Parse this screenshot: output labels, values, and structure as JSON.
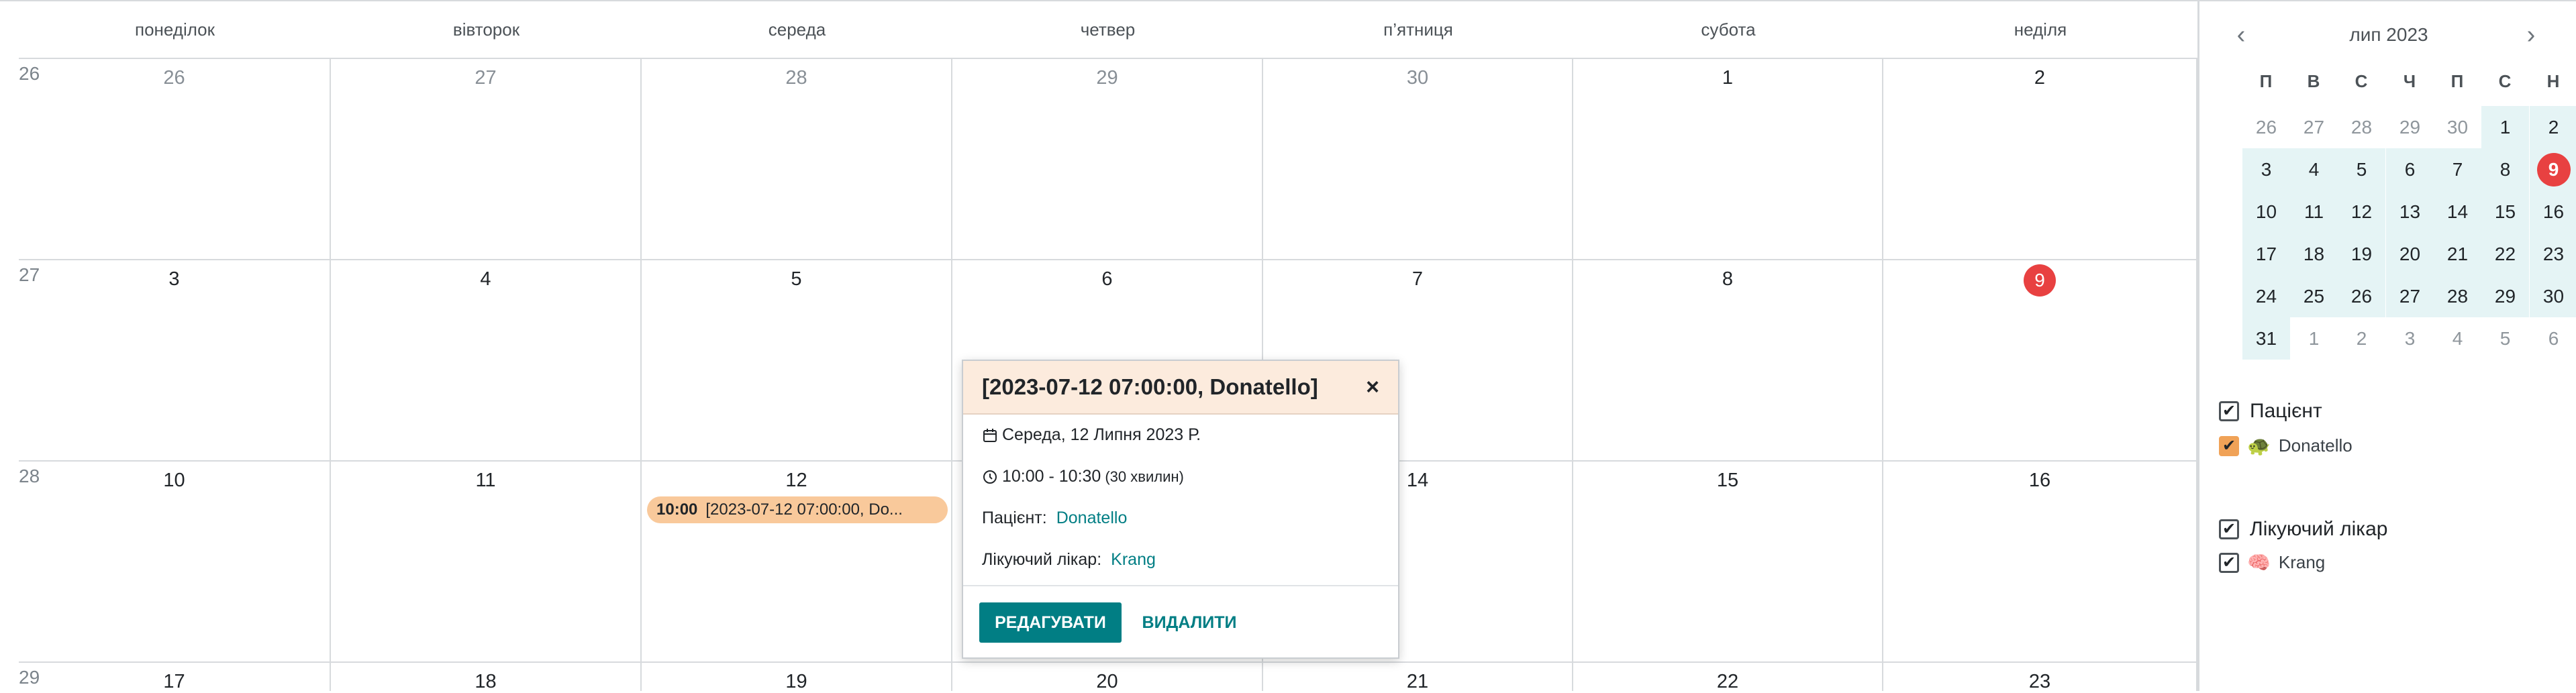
{
  "weekdays": [
    "понеділок",
    "вівторок",
    "середа",
    "четвер",
    "п’ятниця",
    "субота",
    "неділя"
  ],
  "weeks": [
    {
      "num": "26",
      "days": [
        "26",
        "27",
        "28",
        "29",
        "30",
        "1",
        "2"
      ],
      "muted": [
        1,
        1,
        1,
        1,
        1,
        0,
        0
      ]
    },
    {
      "num": "27",
      "days": [
        "3",
        "4",
        "5",
        "6",
        "7",
        "8",
        "9"
      ],
      "muted": [
        0,
        0,
        0,
        0,
        0,
        0,
        0
      ]
    },
    {
      "num": "28",
      "days": [
        "10",
        "11",
        "12",
        "13",
        "14",
        "15",
        "16"
      ],
      "muted": [
        0,
        0,
        0,
        0,
        0,
        0,
        0
      ]
    },
    {
      "num": "29",
      "days": [
        "17",
        "18",
        "19",
        "20",
        "21",
        "22",
        "23"
      ],
      "muted": [
        0,
        0,
        0,
        0,
        0,
        0,
        0
      ]
    }
  ],
  "today": "9",
  "event": {
    "time": "10:00",
    "title": "[2023-07-12 07:00:00, Do..."
  },
  "popover": {
    "title": "[2023-07-12 07:00:00, Donatello]",
    "close": "×",
    "date": "Середа, 12 Липня 2023 Р.",
    "time": "10:00 - 10:30",
    "duration": "(30 хвилин)",
    "patient_label": "Пацієнт:",
    "patient_value": "Donatello",
    "doctor_label": "Лікуючий лікар:",
    "doctor_value": "Krang",
    "edit_btn": "РЕДАГУВАТИ",
    "delete_btn": "ВИДАЛИТИ"
  },
  "mini": {
    "title": "лип 2023",
    "prev": "‹",
    "next": "›",
    "weekdays": [
      "П",
      "В",
      "С",
      "Ч",
      "П",
      "С",
      "Н"
    ],
    "rows": [
      [
        "26",
        "27",
        "28",
        "29",
        "30",
        "1",
        "2"
      ],
      [
        "3",
        "4",
        "5",
        "6",
        "7",
        "8",
        "9"
      ],
      [
        "10",
        "11",
        "12",
        "13",
        "14",
        "15",
        "16"
      ],
      [
        "17",
        "18",
        "19",
        "20",
        "21",
        "22",
        "23"
      ],
      [
        "24",
        "25",
        "26",
        "27",
        "28",
        "29",
        "30"
      ],
      [
        "31",
        "1",
        "2",
        "3",
        "4",
        "5",
        "6"
      ]
    ]
  },
  "filters": {
    "patient_title": "Пацієнт",
    "patient_item": "Donatello",
    "doctor_title": "Лікуючий лікар",
    "doctor_item": "Krang"
  },
  "colors": {
    "accent": "#017e84",
    "today": "#e84141",
    "event": "#f9c99b",
    "minihl": "#e5f4f5"
  }
}
